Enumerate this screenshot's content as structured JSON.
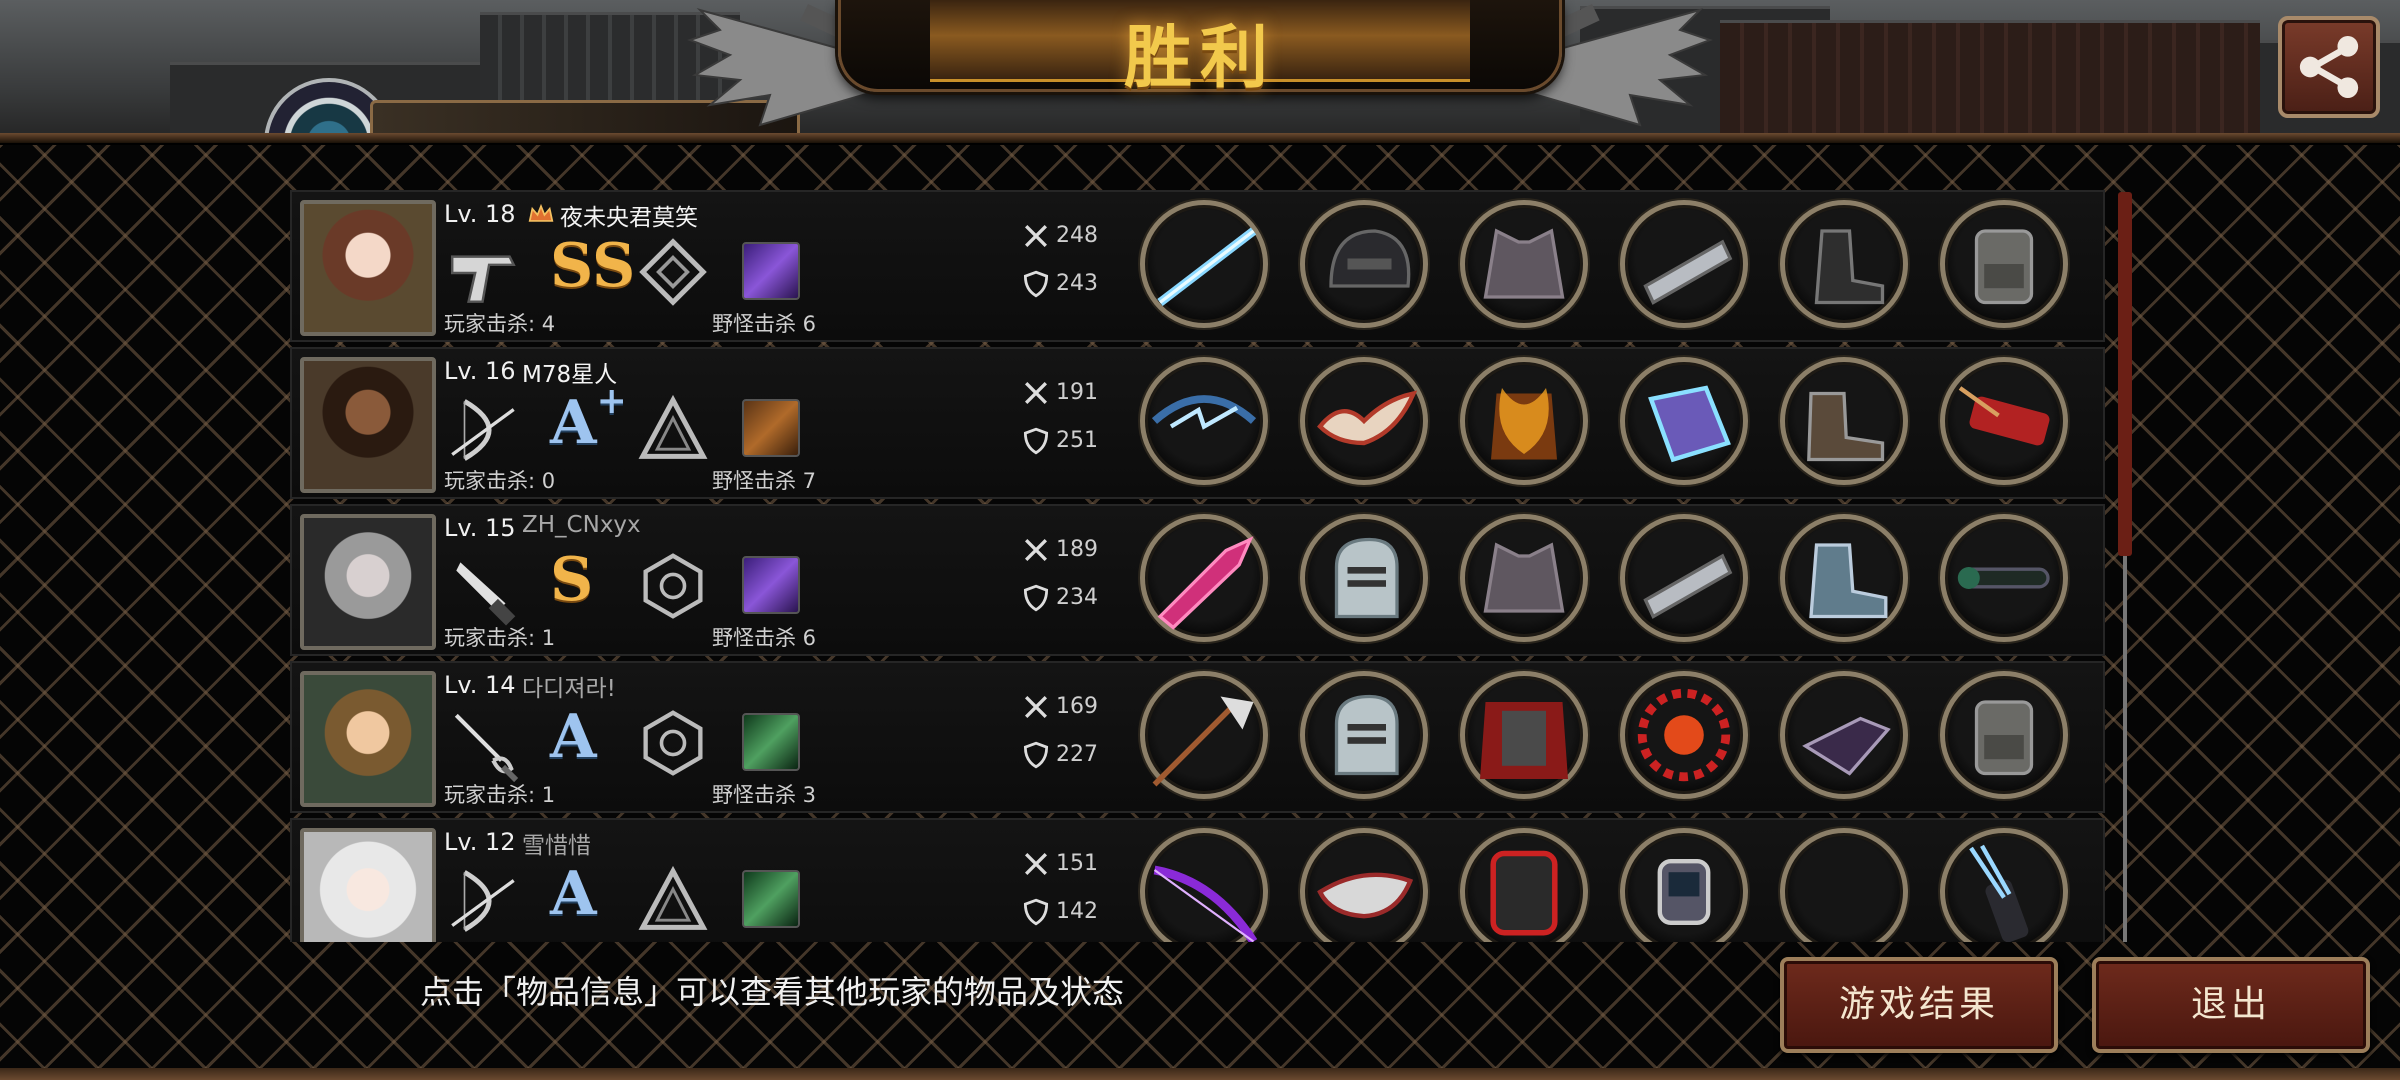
{
  "header": {
    "title": "胜利",
    "share_icon": "share-icon"
  },
  "background_player": {
    "name_partial": "夜未央君莫笑"
  },
  "players": [
    {
      "level": "Lv. 18",
      "name": "夜未央君莫笑",
      "has_crown": true,
      "weapon_icon": "pistol-icon",
      "grade": "SS",
      "grade_color": "gold",
      "role_icon": "diamond-rank-icon",
      "monster_icon": "purple-beast-icon",
      "player_kills": "玩家击杀: 4",
      "monster_kills": "野怪击杀 6",
      "attack": "248",
      "defense": "243",
      "items": [
        "laser-rifle-icon",
        "tactical-helmet-icon",
        "armor-vest-icon",
        "arm-guard-icon",
        "combat-boots-icon",
        "backpack-icon"
      ]
    },
    {
      "level": "Lv. 16",
      "name": "M78星人",
      "has_crown": false,
      "weapon_icon": "bow-icon",
      "grade": "A",
      "grade_plus": "+",
      "grade_color": "blue",
      "role_icon": "triangle-rank-icon",
      "monster_icon": "crossed-swords-icon",
      "player_kills": "玩家击杀: 0",
      "monster_kills": "野怪击杀 7",
      "attack": "191",
      "defense": "251",
      "items": [
        "lightning-bow-icon",
        "winged-mask-icon",
        "flame-armor-icon",
        "energy-gauntlet-icon",
        "leather-boots-icon",
        "quiver-icon"
      ]
    },
    {
      "level": "Lv. 15",
      "name": "ZH_CNxyx",
      "has_crown": false,
      "weapon_icon": "knife-icon",
      "grade": "S",
      "grade_color": "gold",
      "role_icon": "hexagon-rank-icon",
      "monster_icon": "purple-beast-icon",
      "player_kills": "玩家击杀: 1",
      "monster_kills": "野怪击杀 6",
      "attack": "189",
      "defense": "234",
      "items": [
        "crystal-blade-icon",
        "knight-helmet-icon",
        "armor-vest-icon",
        "arm-guard-icon",
        "steel-boots-icon",
        "scope-icon"
      ]
    },
    {
      "level": "Lv. 14",
      "name": "다디져라!",
      "has_crown": false,
      "weapon_icon": "rapier-icon",
      "grade": "A",
      "grade_color": "blue",
      "role_icon": "hexagon-rank-icon",
      "monster_icon": "green-zombie-icon",
      "player_kills": "玩家击杀: 1",
      "monster_kills": "野怪击杀 3",
      "attack": "169",
      "defense": "227",
      "items": [
        "halberd-icon",
        "knight-helmet-icon",
        "caped-armor-icon",
        "ruby-amulet-icon",
        "claw-gloves-icon",
        "backpack-icon"
      ]
    },
    {
      "level": "Lv. 12",
      "name": "雪惜惜",
      "has_crown": false,
      "weapon_icon": "bow-icon",
      "grade": "A",
      "grade_color": "blue",
      "role_icon": "triangle-rank-icon",
      "monster_icon": "green-zombie-icon",
      "player_kills": "",
      "monster_kills": "",
      "attack": "151",
      "defense": "142",
      "items": [
        "violet-bow-icon",
        "silver-mask-icon",
        "red-backpack-armor-icon",
        "smart-watch-icon",
        "empty-slot",
        "arrow-quiver-icon"
      ]
    }
  ],
  "footer": {
    "hint": "点击「物品信息」可以查看其他玩家的物品及状态",
    "result_button": "游戏结果",
    "exit_button": "退出"
  },
  "colors": {
    "gold": "#f1b44a",
    "accent_red": "#6e2a1c",
    "frame": "#8c7f68"
  }
}
